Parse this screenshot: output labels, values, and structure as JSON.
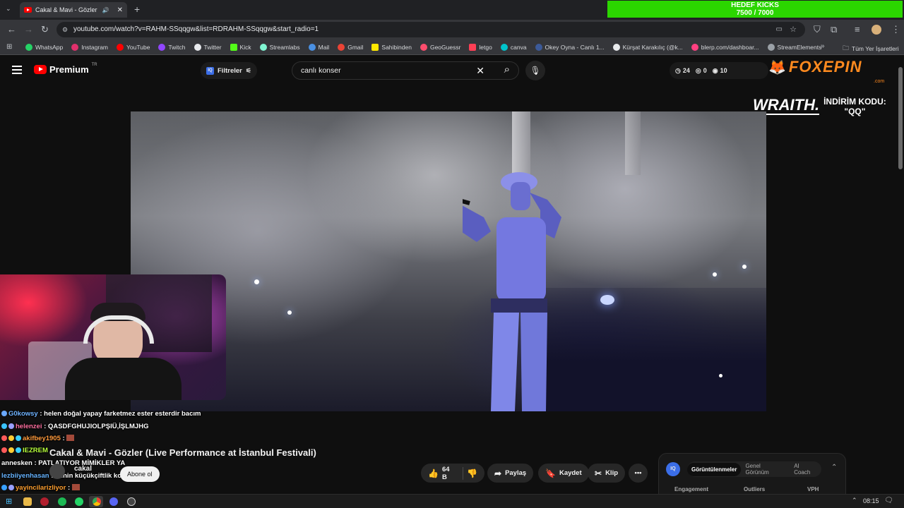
{
  "browser": {
    "tab_title": "Cakal & Mavi - Gözler (Live",
    "new_tab_icon": "plus-icon",
    "url": "youtube.com/watch?v=RAHM-SSqqgw&list=RDRAHM-SSqqgw&start_radio=1"
  },
  "goal": {
    "title": "HEDEF KICKS",
    "progress": "7500 / 7000"
  },
  "bookmarks": [
    {
      "label": "WhatsApp",
      "color": "#25d366"
    },
    {
      "label": "Instagram",
      "color": "#e1306c"
    },
    {
      "label": "YouTube",
      "color": "#ff0000"
    },
    {
      "label": "Twitch",
      "color": "#9146ff"
    },
    {
      "label": "Twitter",
      "color": "#e8eaed"
    },
    {
      "label": "Kick",
      "color": "#53fc18"
    },
    {
      "label": "Streamlabs",
      "color": "#80f5d2"
    },
    {
      "label": "Mail",
      "color": "#4a90e2"
    },
    {
      "label": "Gmail",
      "color": "#ea4335"
    },
    {
      "label": "Sahibinden",
      "color": "#ffe800"
    },
    {
      "label": "GeoGuessr",
      "color": "#ff4d6d"
    },
    {
      "label": "letgo",
      "color": "#ff3f55"
    },
    {
      "label": "canva",
      "color": "#00c4cc"
    },
    {
      "label": "Okey Oyna - Canlı 1...",
      "color": "#3c5a99"
    },
    {
      "label": "Kürşat Karakılıç (@k...",
      "color": "#e8eaed"
    },
    {
      "label": "blerp.com/dashboar...",
      "color": "#ff4081"
    },
    {
      "label": "StreamElements",
      "color": "#9aa0a6"
    }
  ],
  "bookmarks_all": "Tüm Yer İşaretleri",
  "youtube": {
    "logo_text": "Premium",
    "region": "TR",
    "filters_label": "Filtreler",
    "search_value": "canlı konser",
    "stats": {
      "a": "24",
      "b": "0",
      "c": "10"
    }
  },
  "sponsor": {
    "brand": "FOXEPIN",
    "domain": ".com",
    "code_brand": "WRAITH.",
    "code_label": "İNDİRİM KODU:",
    "code_value": "\"QQ\""
  },
  "video": {
    "title": "Cakal & Mavi - Gözler (Live Performance at İstanbul Festivali)",
    "channel": "cakal",
    "subscribe_label": "Abone ol",
    "like_count": "64 B",
    "share_label": "Paylaş",
    "save_label": "Kaydet",
    "clip_label": "Klip"
  },
  "chat": [
    {
      "user": "G0kowsy",
      "msg": ": helen doğal yapay farketmez ester esterdir bacım",
      "color": "#6fb3ff"
    },
    {
      "user": "helenzei",
      "msg": ": QASDFGHUJIOLPŞIÜ,İŞLMJHG",
      "color": "#ff6f9f"
    },
    {
      "user": "akifbey1905",
      "msg": ":",
      "color": "#ff9a3c"
    },
    {
      "user": "IEZREM",
      "msg": "",
      "color": "#b7ff3c"
    },
    {
      "user": "annesken",
      "msg": ": PATLATIYOR MİMİKLER YA",
      "color": "#ffffff"
    },
    {
      "user": "lezbiiyenhasan",
      "msg": ": atinin küçükçiftlik konserine bak",
      "color": "#66b3ff"
    },
    {
      "user": "yayincilarizliyor",
      "msg": ":",
      "color": "#ff9f2f"
    }
  ],
  "iq_panel": {
    "tabs": [
      "Görüntülenmeler",
      "Genel Görünüm",
      "AI Coach"
    ],
    "columns": [
      "Engagement",
      "Outliers",
      "VPH"
    ]
  },
  "taskbar": {
    "time": "08:15"
  }
}
